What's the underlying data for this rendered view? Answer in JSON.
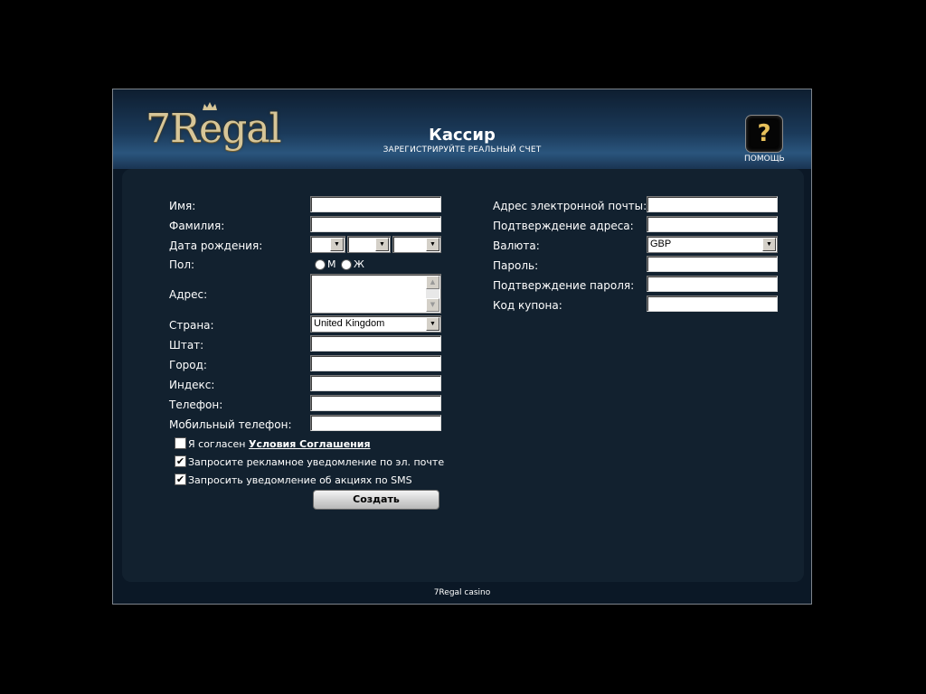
{
  "header": {
    "logo_text": "7Regal",
    "title": "Кассир",
    "subtitle": "ЗАРЕГИСТРИРУЙТЕ РЕАЛЬНЫЙ СЧЕТ",
    "help_label": "ПОМОЩЬ",
    "help_glyph": "?"
  },
  "form_left": {
    "first_name_label": "Имя:",
    "last_name_label": "Фамилия:",
    "birthdate_label": "Дата рождения:",
    "gender_label": "Пол:",
    "gender_male": "М",
    "gender_female": "Ж",
    "address_label": "Адрес:",
    "country_label": "Страна:",
    "country_value": "United Kingdom",
    "state_label": "Штат:",
    "city_label": "Город:",
    "zip_label": "Индекс:",
    "phone_label": "Телефон:",
    "mobile_label": "Мобильный телефон:"
  },
  "form_right": {
    "email_label": "Адрес электронной почты:",
    "email_confirm_label": "Подтверждение адреса:",
    "currency_label": "Валюта:",
    "currency_value": "GBP",
    "password_label": "Пароль:",
    "password_confirm_label": "Подтверждение пароля:",
    "coupon_label": "Код купона:"
  },
  "checkboxes": {
    "agree_prefix": "Я согласен",
    "agree_link": "Условия Соглашения",
    "agree_checked": false,
    "email_promo": "Запросите рекламное уведомление по эл. почте",
    "email_promo_checked": true,
    "sms_promo": "Запросить уведомление об акциях по SMS",
    "sms_promo_checked": true
  },
  "create_button": "Создать",
  "footer": "7Regal casino"
}
